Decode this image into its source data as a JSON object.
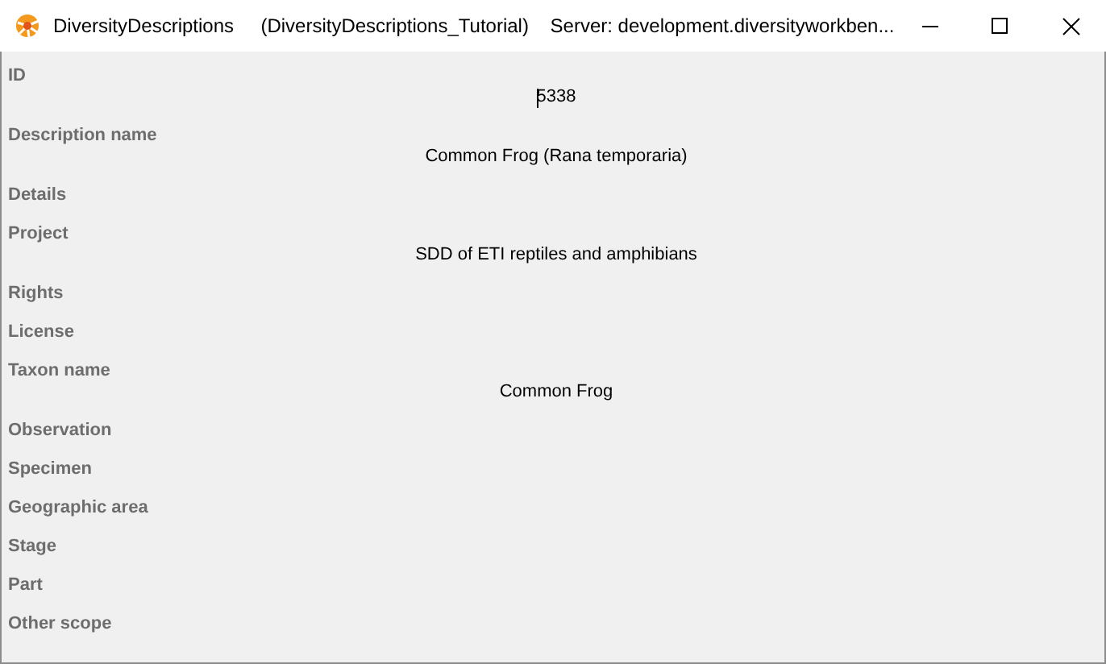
{
  "window": {
    "title": "DiversityDescriptions     (DiversityDescriptions_Tutorial)    Server: development.diversityworkben..."
  },
  "fields": [
    {
      "label": "ID",
      "value": "5338",
      "focused": true
    },
    {
      "label": "Description name",
      "value": "Common Frog (Rana temporaria)",
      "focused": false
    },
    {
      "label": "Details",
      "focused": false
    },
    {
      "label": "Project",
      "value": "SDD of ETI reptiles and amphibians",
      "focused": false
    },
    {
      "label": "Rights",
      "focused": false
    },
    {
      "label": "License",
      "focused": false
    },
    {
      "label": "Taxon name",
      "value": "Common Frog",
      "focused": false
    },
    {
      "label": "Observation",
      "focused": false
    },
    {
      "label": "Specimen",
      "focused": false
    },
    {
      "label": "Geographic area",
      "focused": false
    },
    {
      "label": "Stage",
      "focused": false
    },
    {
      "label": "Part",
      "focused": false
    },
    {
      "label": "Other scope",
      "focused": false
    }
  ]
}
